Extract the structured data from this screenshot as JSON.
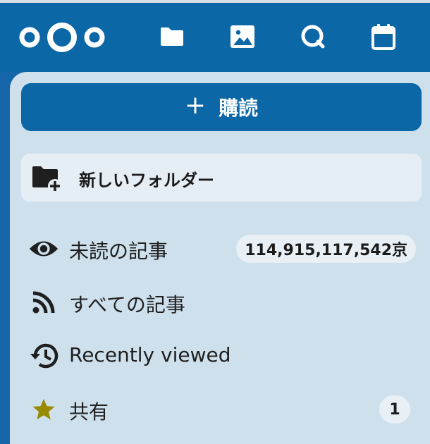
{
  "header": {
    "apps": [
      {
        "name": "folder-icon"
      },
      {
        "name": "image-icon"
      },
      {
        "name": "search-icon"
      },
      {
        "name": "calendar-icon"
      }
    ]
  },
  "subscribe_button": {
    "icon": "plus-icon",
    "label": "購読"
  },
  "new_folder_button": {
    "icon": "folder-plus-icon",
    "label": "新しいフォルダー"
  },
  "nav": {
    "items": [
      {
        "icon": "eye-icon",
        "label": "未読の記事",
        "badge": "114,915,117,542京"
      },
      {
        "icon": "rss-icon",
        "label": "すべての記事"
      },
      {
        "icon": "history-icon",
        "label": "Recently viewed"
      },
      {
        "icon": "star-icon",
        "label": "共有",
        "badge": "1"
      }
    ]
  },
  "colors": {
    "header_bg": "#0b67a6",
    "panel_bg": "#cde0ec",
    "star": "#9a8a00"
  }
}
